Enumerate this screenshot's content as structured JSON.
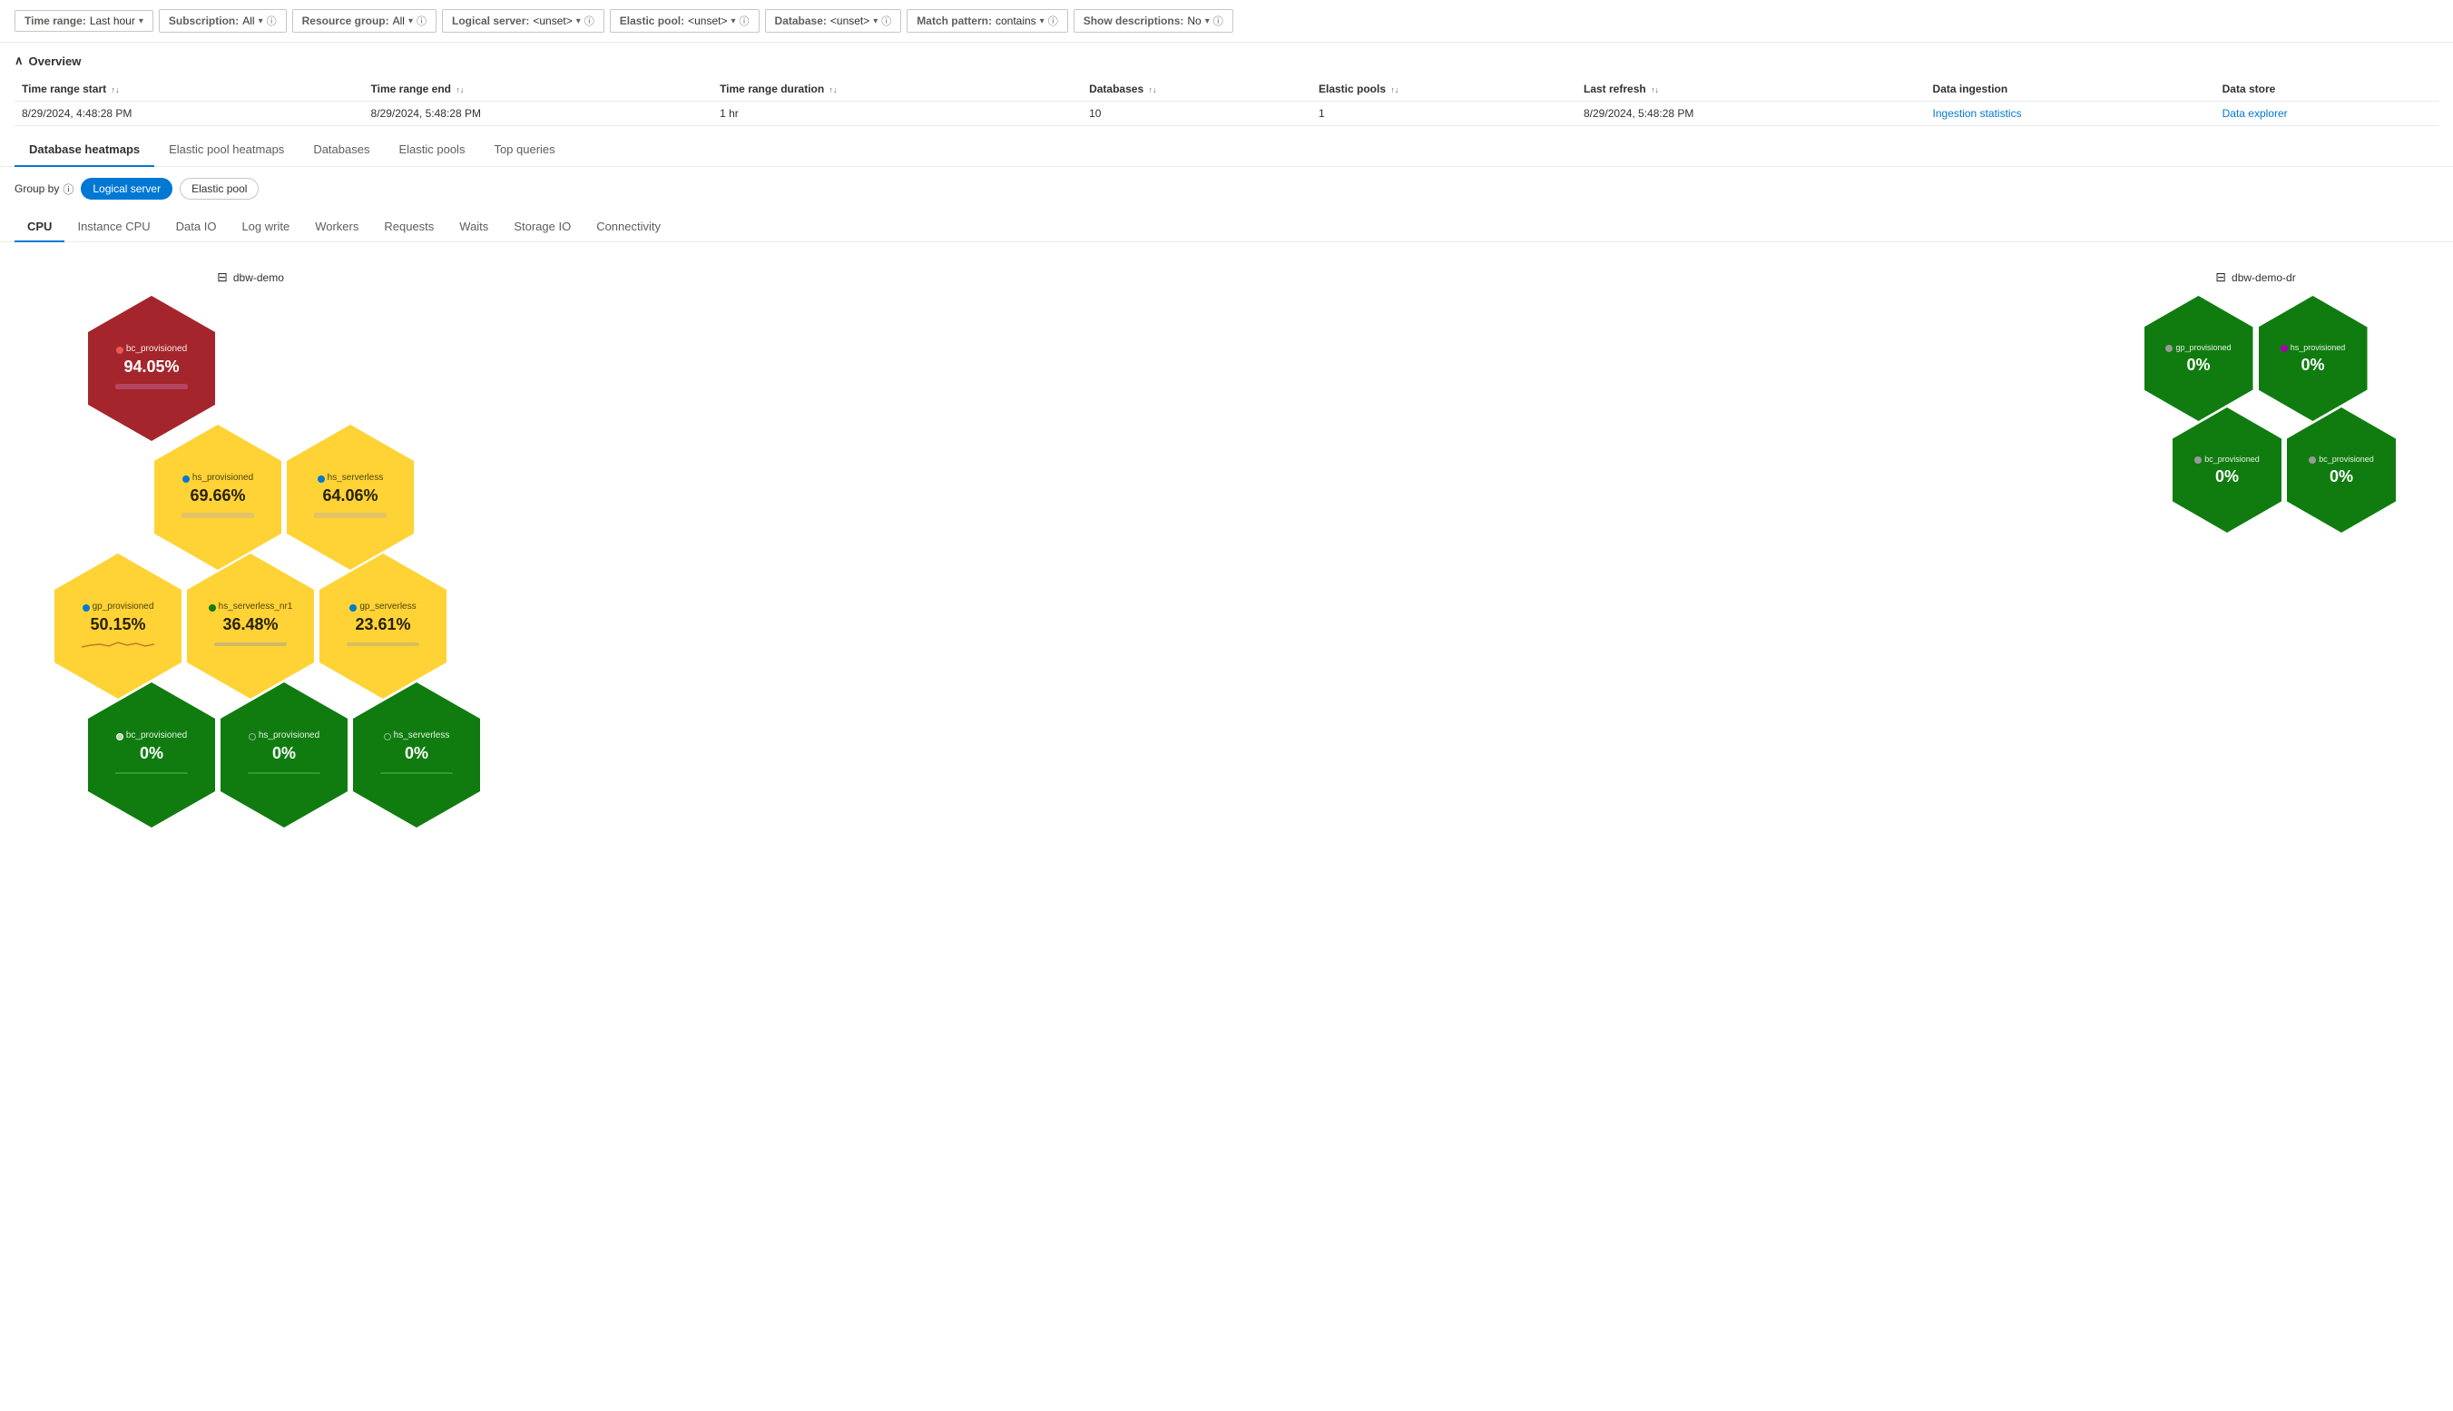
{
  "filterBar": {
    "filters": [
      {
        "id": "time-range",
        "label": "Time range:",
        "value": "Last hour",
        "hasChevron": true,
        "hasInfo": false
      },
      {
        "id": "subscription",
        "label": "Subscription:",
        "value": "All",
        "hasChevron": true,
        "hasInfo": true
      },
      {
        "id": "resource-group",
        "label": "Resource group:",
        "value": "All",
        "hasChevron": true,
        "hasInfo": true
      },
      {
        "id": "logical-server",
        "label": "Logical server:",
        "value": "<unset>",
        "hasChevron": true,
        "hasInfo": true
      },
      {
        "id": "elastic-pool",
        "label": "Elastic pool:",
        "value": "<unset>",
        "hasChevron": true,
        "hasInfo": true
      },
      {
        "id": "database",
        "label": "Database:",
        "value": "<unset>",
        "hasChevron": true,
        "hasInfo": true
      },
      {
        "id": "match-pattern",
        "label": "Match pattern:",
        "value": "contains",
        "hasChevron": true,
        "hasInfo": true
      },
      {
        "id": "show-descriptions",
        "label": "Show descriptions:",
        "value": "No",
        "hasChevron": true,
        "hasInfo": true
      }
    ]
  },
  "overview": {
    "title": "Overview",
    "table": {
      "columns": [
        {
          "id": "time-start",
          "label": "Time range start",
          "sortable": true
        },
        {
          "id": "time-end",
          "label": "Time range end",
          "sortable": true
        },
        {
          "id": "duration",
          "label": "Time range duration",
          "sortable": true
        },
        {
          "id": "databases",
          "label": "Databases",
          "sortable": true
        },
        {
          "id": "elastic-pools",
          "label": "Elastic pools",
          "sortable": true
        },
        {
          "id": "last-refresh",
          "label": "Last refresh",
          "sortable": true
        },
        {
          "id": "data-ingestion",
          "label": "Data ingestion",
          "sortable": false
        },
        {
          "id": "data-store",
          "label": "Data store",
          "sortable": false
        }
      ],
      "rows": [
        {
          "timeStart": "8/29/2024, 4:48:28 PM",
          "timeEnd": "8/29/2024, 5:48:28 PM",
          "duration": "1 hr",
          "databases": "10",
          "elasticPools": "1",
          "lastRefresh": "8/29/2024, 5:48:28 PM",
          "dataIngestion": "Ingestion statistics",
          "dataIngestionLink": true,
          "dataStore": "Data explorer",
          "dataStoreLink": true
        }
      ]
    }
  },
  "mainTabs": {
    "tabs": [
      {
        "id": "database-heatmaps",
        "label": "Database heatmaps",
        "active": true
      },
      {
        "id": "elastic-pool-heatmaps",
        "label": "Elastic pool heatmaps",
        "active": false
      },
      {
        "id": "databases",
        "label": "Databases",
        "active": false
      },
      {
        "id": "elastic-pools",
        "label": "Elastic pools",
        "active": false
      },
      {
        "id": "top-queries",
        "label": "Top queries",
        "active": false
      }
    ]
  },
  "groupBy": {
    "label": "Group by",
    "options": [
      {
        "id": "logical-server",
        "label": "Logical server",
        "active": true
      },
      {
        "id": "elastic-pool",
        "label": "Elastic pool",
        "active": false
      }
    ]
  },
  "metricTabs": {
    "tabs": [
      {
        "id": "cpu",
        "label": "CPU",
        "active": true
      },
      {
        "id": "instance-cpu",
        "label": "Instance CPU",
        "active": false
      },
      {
        "id": "data-io",
        "label": "Data IO",
        "active": false
      },
      {
        "id": "log-write",
        "label": "Log write",
        "active": false
      },
      {
        "id": "workers",
        "label": "Workers",
        "active": false
      },
      {
        "id": "requests",
        "label": "Requests",
        "active": false
      },
      {
        "id": "waits",
        "label": "Waits",
        "active": false
      },
      {
        "id": "storage-io",
        "label": "Storage IO",
        "active": false
      },
      {
        "id": "connectivity",
        "label": "Connectivity",
        "active": false
      }
    ]
  },
  "heatmapClusters": [
    {
      "id": "dbw-demo",
      "title": "dbw-demo",
      "rows": [
        [
          {
            "label": "bc_provisioned",
            "value": "94.05%",
            "color": "red",
            "dotColor": "#e00",
            "sparklineColor": "rgba(200,100,150,0.7)"
          }
        ],
        [
          {
            "label": "hs_provisioned",
            "value": "69.66%",
            "color": "yellow",
            "dotColor": "#0078d4",
            "sparklineColor": "rgba(200,180,150,0.5)"
          },
          {
            "label": "hs_serverless",
            "value": "64.06%",
            "color": "yellow",
            "dotColor": "#0078d4",
            "sparklineColor": "rgba(200,180,150,0.5)"
          }
        ],
        [
          {
            "label": "gp_provisioned",
            "value": "50.15%",
            "color": "yellow",
            "dotColor": "#0078d4",
            "sparklineColor": "rgba(220,150,100,0.7)"
          },
          {
            "label": "hs_serverless_nr1",
            "value": "36.48%",
            "color": "yellow",
            "dotColor": "#107c10",
            "sparklineColor": "rgba(160,160,160,0.5)"
          },
          {
            "label": "gp_serverless",
            "value": "23.61%",
            "color": "yellow",
            "dotColor": "#0078d4",
            "sparklineColor": "rgba(160,160,160,0.4)"
          }
        ],
        [
          {
            "label": "bc_provisioned",
            "value": "0%",
            "color": "green",
            "dotColor": "#fff",
            "sparklineColor": "rgba(100,180,100,0.4)"
          },
          {
            "label": "hs_provisioned",
            "value": "0%",
            "color": "green",
            "dotColor": "#107c10",
            "sparklineColor": "rgba(100,180,100,0.4)"
          },
          {
            "label": "hs_serverless",
            "value": "0%",
            "color": "green",
            "dotColor": "#107c10",
            "sparklineColor": "rgba(100,180,100,0.4)"
          }
        ]
      ]
    },
    {
      "id": "dbw-demo-dr",
      "title": "dbw-demo-dr",
      "rows": [
        [
          {
            "label": "gp_provisioned",
            "value": "0%",
            "color": "green",
            "dotColor": "#999",
            "sparklineColor": "rgba(100,180,100,0.3)"
          },
          {
            "label": "hs_provisioned",
            "value": "0%",
            "color": "green",
            "dotColor": "#a0a",
            "sparklineColor": "rgba(100,180,100,0.3)"
          }
        ],
        [
          {
            "label": "bc_provisioned",
            "value": "0%",
            "color": "green",
            "dotColor": "#999",
            "sparklineColor": "rgba(100,180,100,0.3)"
          },
          {
            "label": "bc_provisioned",
            "value": "0%",
            "color": "green",
            "dotColor": "#999",
            "sparklineColor": "rgba(100,180,100,0.3)"
          }
        ]
      ]
    }
  ]
}
